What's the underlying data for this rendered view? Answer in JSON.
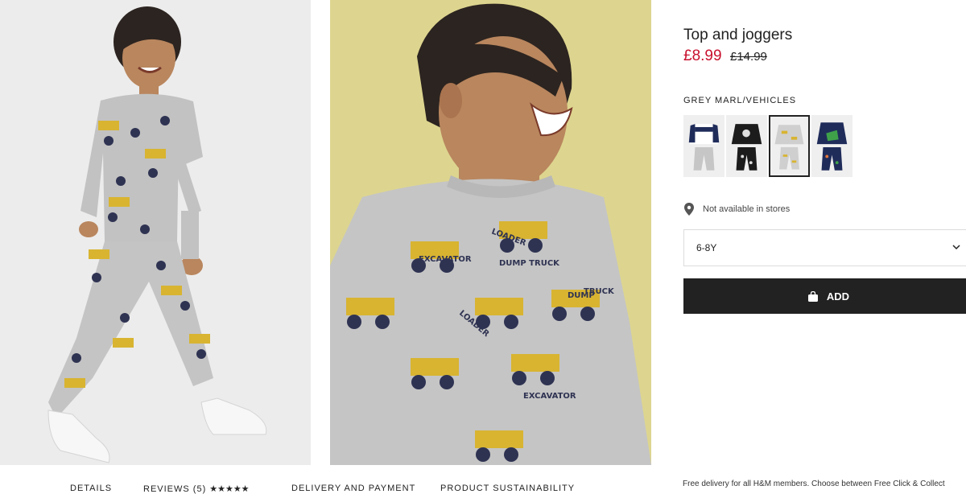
{
  "product": {
    "title": "Top and joggers",
    "price_sale": "£8.99",
    "price_original": "£14.99",
    "color_name": "GREY MARL/VEHICLES",
    "swatches": [
      {
        "name": "navy-grey-newyork",
        "selected": false,
        "tag": "NEW YORK"
      },
      {
        "name": "black-space",
        "selected": false,
        "tag": ""
      },
      {
        "name": "grey-marl-vehicles",
        "selected": true,
        "tag": ""
      },
      {
        "name": "navy-dinosaur",
        "selected": false,
        "tag": ""
      }
    ],
    "store_availability": "Not available in stores",
    "size": "6-8Y",
    "add_label": "ADD"
  },
  "tabs": {
    "details": "DETAILS",
    "reviews": "REVIEWS (5)",
    "reviews_stars": "★★★★★",
    "delivery": "DELIVERY AND PAYMENT",
    "sustainability": "PRODUCT SUSTAINABILITY"
  },
  "delivery_note": "Free delivery for all H&M members. Choose between Free Click & Collect",
  "images": {
    "photo_left": "boy-walking-in-vehicle-print-pyjamas",
    "photo_main": "boy-smiling-closeup",
    "print_labels": [
      "LOADER",
      "EXCAVATOR",
      "DUMP TRUCK",
      "LOADER",
      "DUMP",
      "TRUCK",
      "EXCAVATOR"
    ]
  },
  "colors": {
    "sale_red": "#c8102e",
    "button_dark": "#222222",
    "main_photo_bg": "#ddd58f",
    "left_photo_bg": "#ececec"
  }
}
